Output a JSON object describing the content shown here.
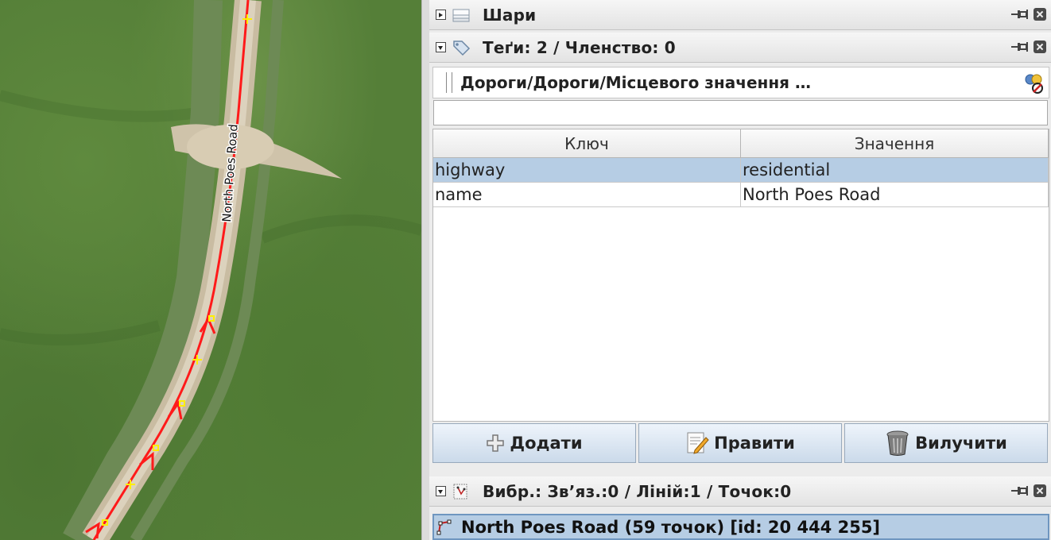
{
  "map": {
    "road_label": "North Poes Road"
  },
  "layers_dialog": {
    "title": "Шари"
  },
  "tags_dialog": {
    "title": "Теґи: 2 / Членство: 0",
    "preset_name": "Дороги/Дороги/Місцевого значення …",
    "filter_value": "",
    "columns": [
      "Ключ",
      "Значення"
    ],
    "rows": [
      {
        "key": "highway",
        "value": "residential",
        "selected": true
      },
      {
        "key": "name",
        "value": "North Poes Road",
        "selected": false
      }
    ],
    "buttons": {
      "add": "Додати",
      "edit": "Правити",
      "delete": "Вилучити"
    }
  },
  "selection_dialog": {
    "title": "Вибр.: Зв’яз.:0 / Ліній:1 / Точок:0",
    "items": [
      {
        "label": "North Poes Road (59 точок) [id: 20 444 255]"
      }
    ]
  },
  "colors": {
    "selected_row": "#b6cde4",
    "way_highlight": "#ff1a1a",
    "node_marker": "#ffee00"
  },
  "icons": {
    "layers": "layers-icon",
    "tags": "tag-icon",
    "pin": "pin-icon",
    "close": "close-icon",
    "add": "plus-icon",
    "edit": "pencil-note-icon",
    "delete": "trash-can-icon",
    "selection": "selection-icon",
    "way": "way-icon",
    "preset_search": "preset-search-icon"
  }
}
